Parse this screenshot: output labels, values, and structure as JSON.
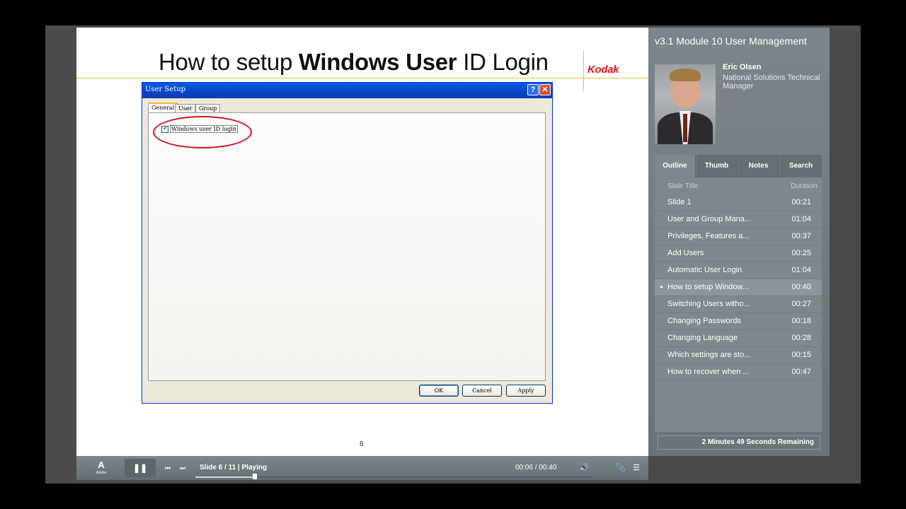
{
  "slide": {
    "title_plain_1": "How to setup ",
    "title_bold": "Windows User",
    "title_plain_2": " ID Login",
    "logo_text": "Kodak",
    "page_number": "6",
    "dialog": {
      "title": "User Setup",
      "help_glyph": "?",
      "close_glyph": "✕",
      "tabs": [
        "General",
        "User",
        "Group"
      ],
      "checkbox_label": "Windows user ID login",
      "checkbox_checked": true,
      "ok_label": "OK",
      "cancel_label": "Cancel",
      "apply_label": "Apply"
    }
  },
  "side": {
    "course_title": "v3.1 Module 10 User Management",
    "presenter_name": "Eric Olsen",
    "presenter_role": "National Solutions Technical Manager",
    "tabs": [
      "Outline",
      "Thumb",
      "Notes",
      "Search"
    ],
    "col_title": "Slide Title",
    "col_duration": "Duration",
    "outline": [
      {
        "title": "Slide 1",
        "duration": "00:21"
      },
      {
        "title": "User and Group Mana...",
        "duration": "01:04"
      },
      {
        "title": "Privileges, Features a...",
        "duration": "00:37"
      },
      {
        "title": "Add Users",
        "duration": "00:25"
      },
      {
        "title": "Automatic User Login",
        "duration": "01:04"
      },
      {
        "title": "How to setup Window...",
        "duration": "00:40"
      },
      {
        "title": "Switching Users witho...",
        "duration": "00:27"
      },
      {
        "title": "Changing Passwords",
        "duration": "00:18"
      },
      {
        "title": "Changing Language",
        "duration": "00:28"
      },
      {
        "title": "Which settings are sto...",
        "duration": "00:15"
      },
      {
        "title": "How to recover when ...",
        "duration": "00:47"
      }
    ],
    "active_index": 5,
    "remaining": "2 Minutes 49 Seconds Remaining"
  },
  "controls": {
    "adobe_mark": "A",
    "adobe_word": "Adobe",
    "pause_glyph": "❚❚",
    "prev_glyph": "⏮",
    "next_glyph": "⏭",
    "slide_status": "Slide 6 / 11 | Playing",
    "time": "00:06 / 00:40",
    "progress_fraction": 0.15,
    "volume_glyph": "🔊",
    "attach_glyph": "📎",
    "menu_glyph": "☰"
  },
  "icons": {
    "help": "help-icon",
    "close": "close-icon",
    "pause": "pause-icon",
    "prev": "previous-icon",
    "next": "next-icon",
    "volume": "volume-icon",
    "attach": "attachment-icon",
    "menu": "menu-icon"
  },
  "colors": {
    "xp_title_blue": "#0844c7",
    "highlight_red": "#d01020",
    "kodak_red": "#d41920",
    "player_gray": "#7d878c"
  }
}
